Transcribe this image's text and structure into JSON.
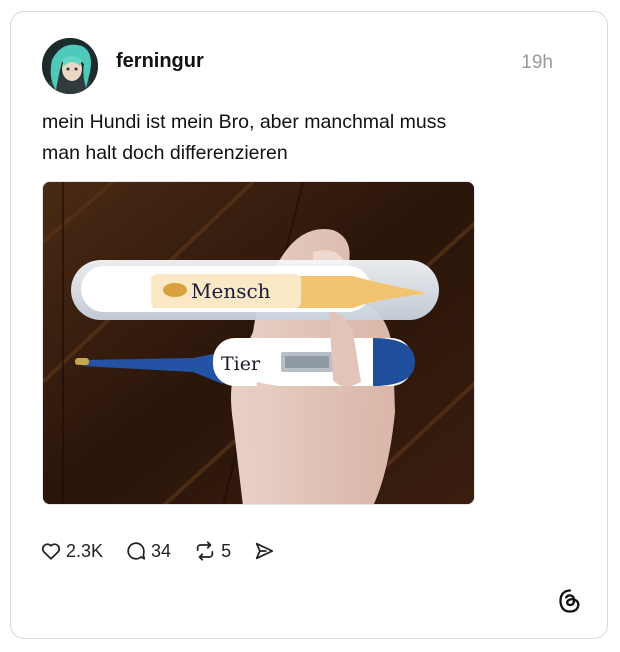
{
  "post": {
    "username": "ferningur",
    "timestamp": "19h",
    "text_line1": "mein Hundi ist mein Bro, aber manchmal muss",
    "text_line2": "man halt doch differenzieren"
  },
  "photo": {
    "thermometer_top_label": "Mensch",
    "thermometer_bottom_label": "Tier"
  },
  "actions": {
    "like_count": "2.3K",
    "reply_count": "34",
    "repost_count": "5"
  },
  "icons": {
    "like": "heart-icon",
    "reply": "comment-bubble-icon",
    "repost": "repost-arrows-icon",
    "share": "send-icon",
    "brand": "threads-logo-icon"
  }
}
